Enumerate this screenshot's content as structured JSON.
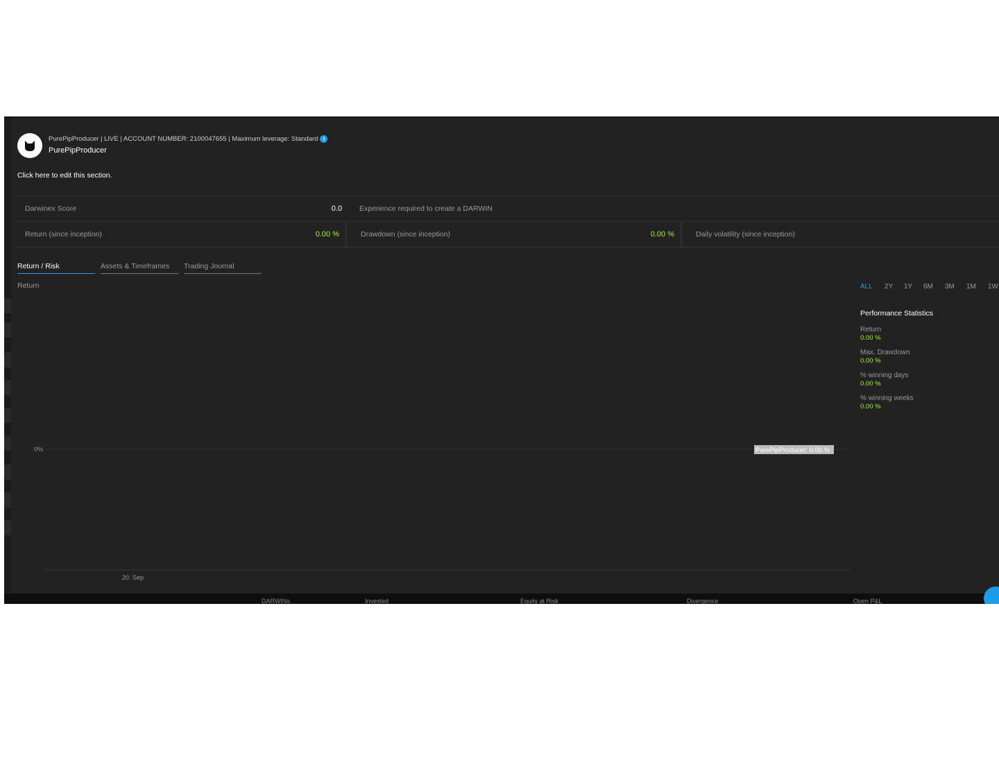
{
  "header": {
    "meta_line": "PurePipProducer | LIVE | ACCOUNT NUMBER: 2100047655 | Maximum leverage: Standard",
    "name": "PurePipProducer",
    "edit_text": "Click here to edit this section."
  },
  "stats": {
    "darwinex_score_label": "Darwinex Score",
    "darwinex_score_value": "0.0",
    "experience_label": "Experience required to create a DARWIN",
    "return_label": "Return (since inception)",
    "return_value": "0.00 %",
    "drawdown_label": "Drawdown (since inception)",
    "drawdown_value": "0.00 %",
    "volatility_label": "Daily volatility (since inception)"
  },
  "tabs": [
    "Return / Risk",
    "Assets & Timeframes",
    "Trading Journal"
  ],
  "chart": {
    "title": "Return",
    "y_tick": "0%",
    "x_tick": "20. Sep",
    "series_label": "PurePipProducer: 0.00 %"
  },
  "ranges": [
    "ALL",
    "2Y",
    "1Y",
    "6M",
    "3M",
    "1M",
    "1W"
  ],
  "performance": {
    "title": "Performance Statistics",
    "items": [
      {
        "label": "Return",
        "value": "0.00 %"
      },
      {
        "label": "Max. Drawdown",
        "value": "0.00 %"
      },
      {
        "label": "% winning days",
        "value": "0.00 %"
      },
      {
        "label": "% winning weeks",
        "value": "0.00 %"
      }
    ]
  },
  "footer": [
    "DARWINs",
    "Invested",
    "Equity at Risk",
    "Divergence",
    "Open P&L"
  ],
  "colors": {
    "accent": "#1e9be9",
    "positive": "#a6f21c",
    "background": "#222222"
  }
}
